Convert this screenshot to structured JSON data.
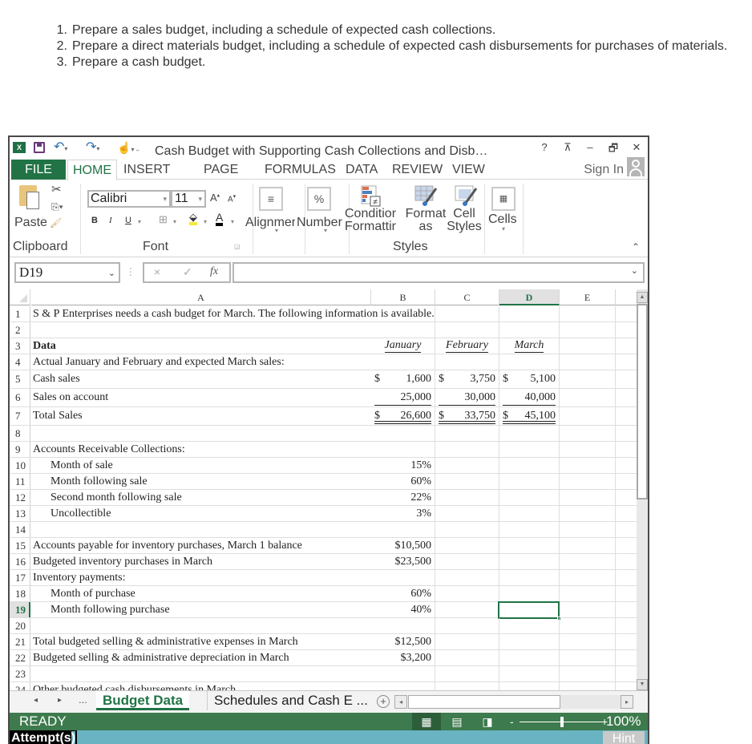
{
  "instructions": [
    {
      "num": "1.",
      "text": "Prepare a sales budget, including a schedule of expected cash collections."
    },
    {
      "num": "2.",
      "text": "Prepare a direct materials budget, including a schedule of expected cash disbursements for purchases of materials."
    },
    {
      "num": "3.",
      "text": "Prepare a cash budget."
    }
  ],
  "window": {
    "title": "Cash Budget with Supporting Cash Collections and Disb…",
    "help": "?",
    "restore_ribbon": "⊼",
    "minimize": "–",
    "restore": "🗗",
    "close": "✕",
    "logo": "X"
  },
  "tabs": {
    "file": "FILE",
    "home": "HOME",
    "insert": "INSERT",
    "page": "PAGE",
    "formulas": "FORMULAS",
    "data": "DATA",
    "review": "REVIEW",
    "view": "VIEW",
    "sign_in": "Sign In"
  },
  "ribbon": {
    "paste": "Paste",
    "clipboard": "Clipboard",
    "font_name": "Calibri",
    "font_size": "11",
    "grow": "A",
    "shrink": "A",
    "bold": "B",
    "italic": "I",
    "underline": "U",
    "font_color": "A",
    "font_group": "Font",
    "alignment": "Alignment",
    "number": "Number",
    "percent": "%",
    "conditional_1": "Conditional",
    "conditional_2": "Formatting",
    "format_as_1": "Format",
    "format_as_2": "as",
    "cell_styles_1": "Cell",
    "cell_styles_2": "Styles",
    "styles_group": "Styles",
    "cells": "Cells"
  },
  "formula_bar": {
    "name_box": "D19",
    "cancel": "×",
    "enter": "✓",
    "fx": "fx",
    "value": ""
  },
  "columns": [
    "A",
    "B",
    "C",
    "D",
    "E"
  ],
  "selected_column": "D",
  "selected_cell": "D19",
  "rows": [
    {
      "n": "1",
      "a": "S & P Enterprises needs a cash budget for March. The following information is available."
    },
    {
      "n": "2",
      "a": ""
    },
    {
      "n": "3",
      "a": "Data",
      "b": "January",
      "c": "February",
      "d": "March"
    },
    {
      "n": "4",
      "a": "Actual January and February and expected March sales:"
    },
    {
      "n": "5",
      "a": "Cash sales",
      "b_cur": "$",
      "b": "1,600",
      "c_cur": "$",
      "c": "3,750",
      "d_cur": "$",
      "d": "5,100"
    },
    {
      "n": "6",
      "a": "Sales on account",
      "b": "25,000",
      "c": "30,000",
      "d": "40,000"
    },
    {
      "n": "7",
      "a": "Total Sales",
      "b_cur": "$",
      "b": "26,600",
      "c_cur": "$",
      "c": "33,750",
      "d_cur": "$",
      "d": "45,100"
    },
    {
      "n": "8",
      "a": ""
    },
    {
      "n": "9",
      "a": "Accounts Receivable Collections:"
    },
    {
      "n": "10",
      "a": "Month of sale",
      "b": "15%"
    },
    {
      "n": "11",
      "a": "Month following sale",
      "b": "60%"
    },
    {
      "n": "12",
      "a": "Second month following sale",
      "b": "22%"
    },
    {
      "n": "13",
      "a": "Uncollectible",
      "b": "3%"
    },
    {
      "n": "14",
      "a": ""
    },
    {
      "n": "15",
      "a": "Accounts payable for inventory purchases, March 1 balance",
      "b": "$10,500"
    },
    {
      "n": "16",
      "a": "Budgeted inventory purchases in March",
      "b": "$23,500"
    },
    {
      "n": "17",
      "a": "Inventory payments:"
    },
    {
      "n": "18",
      "a": "Month of purchase",
      "b": "60%"
    },
    {
      "n": "19",
      "a": "Month following purchase",
      "b": "40%"
    },
    {
      "n": "20",
      "a": ""
    },
    {
      "n": "21",
      "a": "Total budgeted selling & administrative expenses in March",
      "b": "$12,500"
    },
    {
      "n": "22",
      "a": "Budgeted selling & administrative depreciation in March",
      "b": "$3,200"
    },
    {
      "n": "23",
      "a": ""
    },
    {
      "n": "24",
      "a": "Other budgeted cash disbursements in March"
    }
  ],
  "sheet_tabs": {
    "prev": "◂",
    "next": "▸",
    "more": "...",
    "active": "Budget Data",
    "other": "Schedules and Cash E ...",
    "add": "+"
  },
  "status": {
    "mode": "READY",
    "zoom_minus": "-",
    "zoom_plus": "+",
    "zoom_level": "100%",
    "zoom_percent": 100
  },
  "footer": {
    "attempts_label": "Attempt(s",
    "attempts_paren": ")",
    "hint": "Hint"
  }
}
